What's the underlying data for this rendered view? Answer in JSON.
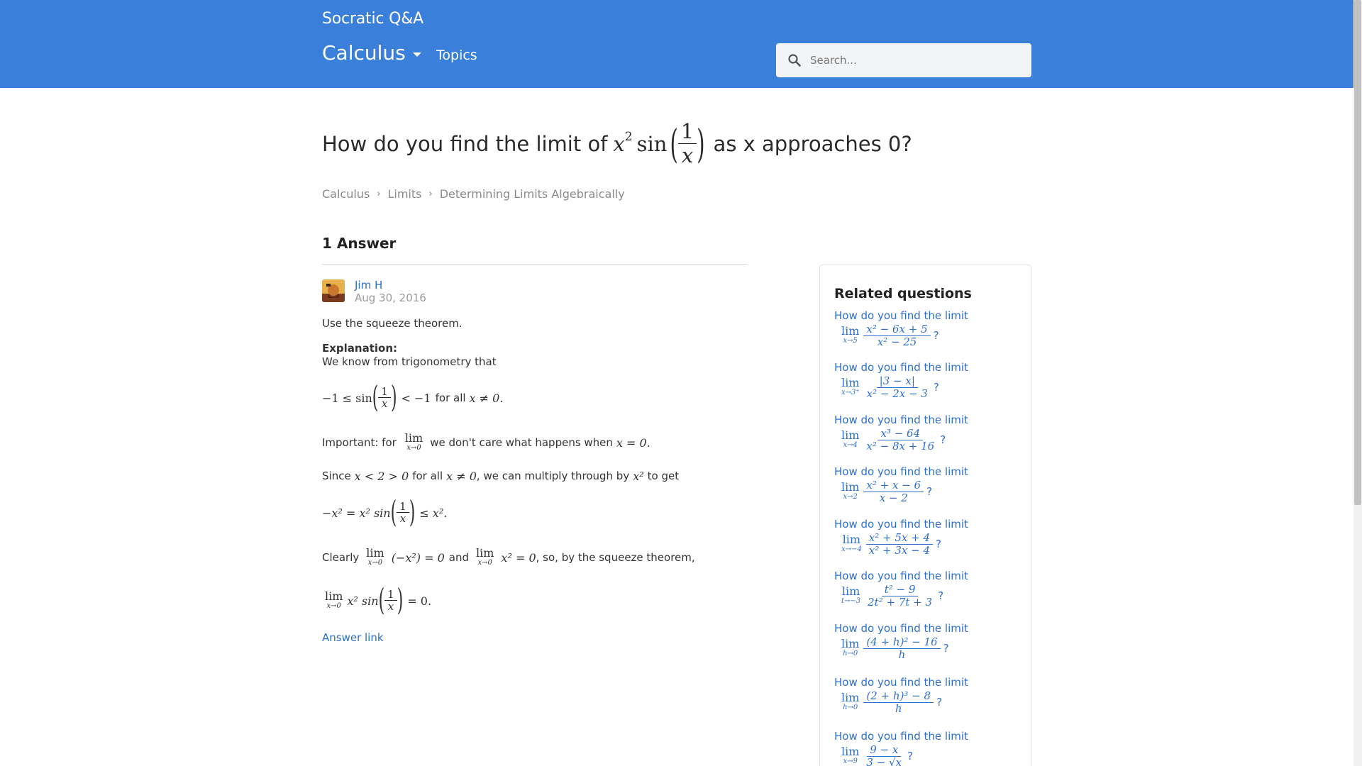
{
  "header": {
    "brand": "Socratic Q&A",
    "subject": "Calculus",
    "topics": "Topics",
    "search_placeholder": "Search...",
    "color": "#3a7fd9"
  },
  "question": {
    "prefix": "How do you find the limit of",
    "expr_base": "x",
    "expr_exp": "2",
    "expr_fn": "sin",
    "expr_num": "1",
    "expr_den": "x",
    "suffix": "as x approaches 0?"
  },
  "breadcrumb": [
    "Calculus",
    "Limits",
    "Determining Limits Algebraically"
  ],
  "answers": {
    "count_label": "1 Answer",
    "author": "Jim H",
    "date": "Aug 30, 2016",
    "summary": "Use the squeeze theorem.",
    "explanation_label": "Explanation:",
    "line1": "We know from trigonometry that",
    "ineq_left": "−1 ≤ sin",
    "ineq_num": "1",
    "ineq_den": "x",
    "ineq_right": "< −1",
    "ineq_tail": "for all",
    "ineq_cond": "x ≠ 0.",
    "important_prefix": "Important: for",
    "important_lim": "lim",
    "important_sub": "x→0",
    "important_suffix": "we don't care what happens when",
    "important_cond": "x = 0.",
    "since_prefix": "Since",
    "since_expr": "x < 2 > 0",
    "since_mid": "for all",
    "since_cond": "x ≠ 0",
    "since_mid2": ", we can multiply through by",
    "since_mult": "x²",
    "since_suffix": "to get",
    "squeeze_left": "−x² = x² sin",
    "squeeze_num": "1",
    "squeeze_den": "x",
    "squeeze_right": "≤ x².",
    "clearly_prefix": "Clearly",
    "clearly_lim": "lim",
    "clearly_sub": "x→0",
    "clearly_expr1": "(−x²) = 0",
    "clearly_and": "and",
    "clearly_expr2": "x² = 0",
    "clearly_suffix": ", so, by the squeeze theorem,",
    "final_lim": "lim",
    "final_sub": "x→0",
    "final_left": "x² sin",
    "final_num": "1",
    "final_den": "x",
    "final_right": "= 0.",
    "answer_link": "Answer link"
  },
  "related": {
    "title": "Related questions",
    "items": [
      {
        "text": "How do you find the limit",
        "lim_sub": "x→5",
        "num": "x² − 6x + 5",
        "den": "x² − 25"
      },
      {
        "text": "How do you find the limit",
        "lim_sub": "x→3⁺",
        "num": "|3 − x|",
        "den": "x² − 2x − 3"
      },
      {
        "text": "How do you find the limit",
        "lim_sub": "x→4",
        "num": "x³ − 64",
        "den": "x² − 8x + 16"
      },
      {
        "text": "How do you find the limit",
        "lim_sub": "x→2",
        "num": "x² + x − 6",
        "den": "x − 2"
      },
      {
        "text": "How do you find the limit",
        "lim_sub": "x→−4",
        "num": "x² + 5x + 4",
        "den": "x² + 3x − 4"
      },
      {
        "text": "How do you find the limit",
        "lim_sub": "t→−3",
        "num": "t² − 9",
        "den": "2t² + 7t + 3"
      },
      {
        "text": "How do you find the limit",
        "lim_sub": "h→0",
        "num": "(4 + h)² − 16",
        "den": "h"
      },
      {
        "text": "How do you find the limit",
        "lim_sub": "h→0",
        "num": "(2 + h)³ − 8",
        "den": "h"
      },
      {
        "text": "How do you find the limit",
        "lim_sub": "x→9",
        "num": "9 − x",
        "den": "3 − √x"
      }
    ]
  }
}
